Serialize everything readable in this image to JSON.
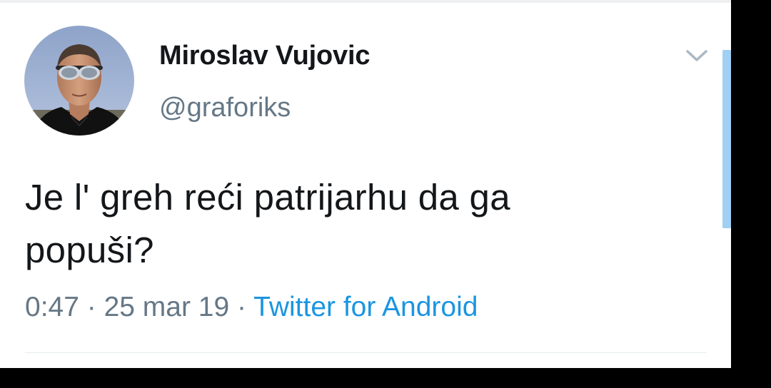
{
  "tweet": {
    "display_name": "Miroslav Vujovic",
    "handle": "@graforiks",
    "text_line_1": "Je l' greh reći patrijarhu da ga",
    "text_line_2": "popuši?",
    "time": "0:47",
    "separator": " · ",
    "date": "25 mar 19",
    "source": "Twitter for Android"
  },
  "icons": {
    "menu": "chevron-down-icon"
  },
  "colors": {
    "name": "#14171a",
    "secondary": "#657786",
    "link": "#1b95e0",
    "scrollbar": "#9fd0f4"
  }
}
